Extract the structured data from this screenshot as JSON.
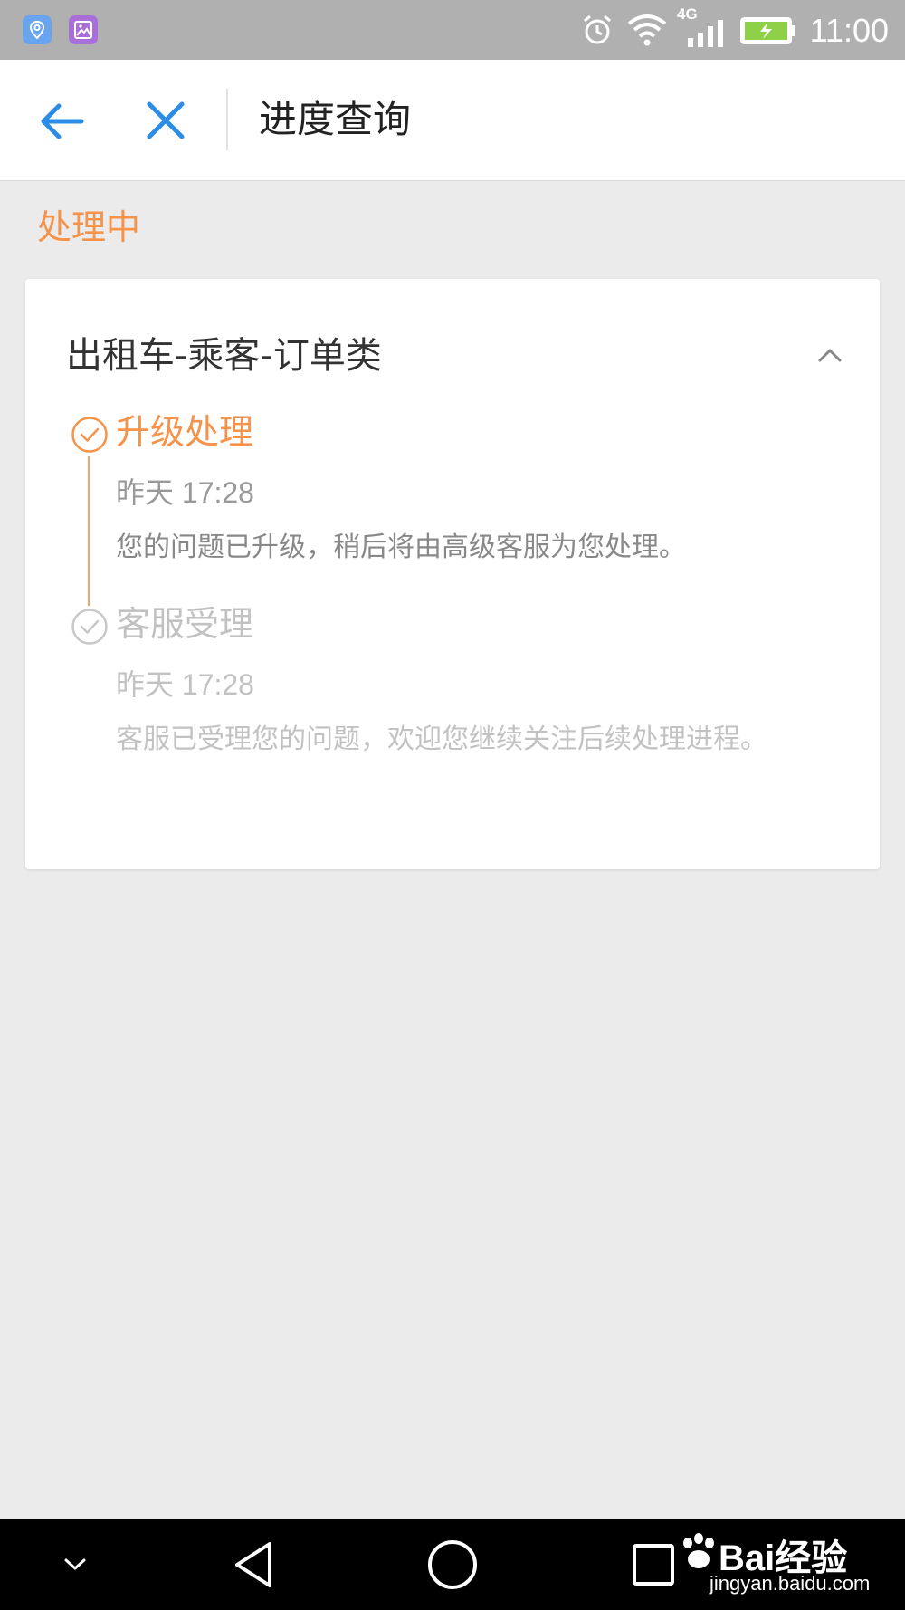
{
  "status_bar": {
    "time": "11:00",
    "network": "4G",
    "icons": [
      "location-app-icon",
      "gallery-app-icon",
      "alarm-icon",
      "wifi-icon",
      "signal-icon",
      "battery-charging-icon"
    ]
  },
  "app_bar": {
    "title": "进度查询",
    "back_icon": "arrow-left-icon",
    "close_icon": "close-icon"
  },
  "section": {
    "label": "处理中"
  },
  "card": {
    "title": "出租车-乘客-订单类",
    "toggle_icon": "chevron-up-icon",
    "steps": [
      {
        "title": "升级处理",
        "time": "昨天 17:28",
        "description": "您的问题已升级，稍后将由高级客服为您处理。",
        "state": "active"
      },
      {
        "title": "客服受理",
        "time": "昨天 17:28",
        "description": "客服已受理您的问题，欢迎您继续关注后续处理进程。",
        "state": "inactive"
      }
    ]
  },
  "nav_bar": {
    "icons": [
      "chevron-down-icon",
      "back-triangle-icon",
      "home-circle-icon",
      "recents-square-icon"
    ]
  },
  "watermark": {
    "line1": "Bai经验",
    "line2": "jingyan.baidu.com"
  },
  "colors": {
    "accent": "#f5934a",
    "link": "#2d8de6",
    "muted": "#c2c2c2",
    "background": "#ebebeb"
  }
}
